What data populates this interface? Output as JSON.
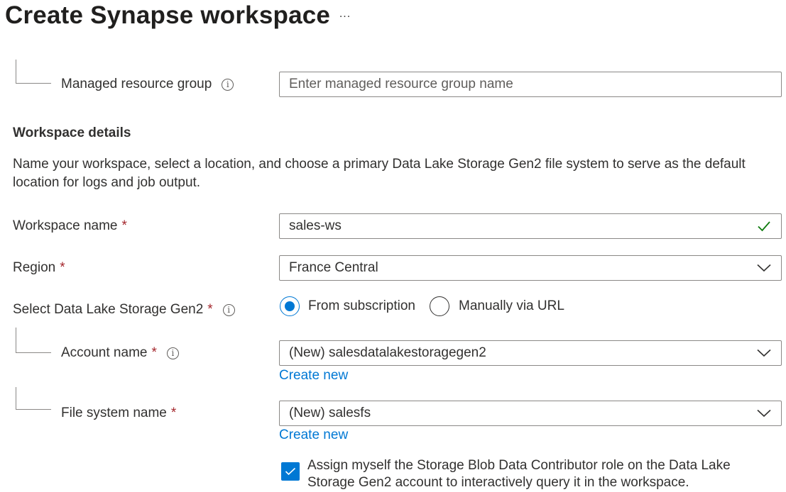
{
  "header": {
    "title": "Create Synapse workspace",
    "more_label": "..."
  },
  "managed_rg": {
    "label": "Managed resource group",
    "placeholder": "Enter managed resource group name"
  },
  "workspace_details": {
    "heading": "Workspace details",
    "description": "Name your workspace, select a location, and choose a primary Data Lake Storage Gen2 file system to serve as the default location for logs and job output."
  },
  "workspace_name": {
    "label": "Workspace name",
    "required_mark": "*",
    "value": "sales-ws",
    "valid_icon": "checkmark-icon"
  },
  "region": {
    "label": "Region",
    "required_mark": "*",
    "selected": "France Central"
  },
  "datalake": {
    "label": "Select Data Lake Storage Gen2",
    "required_mark": "*",
    "options": [
      {
        "label": "From subscription",
        "checked": true
      },
      {
        "label": "Manually via URL",
        "checked": false
      }
    ]
  },
  "account_name": {
    "label": "Account name",
    "required_mark": "*",
    "selected": "(New) salesdatalakestoragegen2",
    "create_new": "Create new"
  },
  "file_system_name": {
    "label": "File system name",
    "required_mark": "*",
    "selected": "(New) salesfs",
    "create_new": "Create new"
  },
  "assign_role": {
    "checked": true,
    "label": "Assign myself the Storage Blob Data Contributor role on the Data Lake Storage Gen2 account to interactively query it in the workspace."
  },
  "colors": {
    "accent": "#0078d4",
    "required": "#a4262c",
    "valid": "#107c10",
    "border": "#8a8886"
  }
}
